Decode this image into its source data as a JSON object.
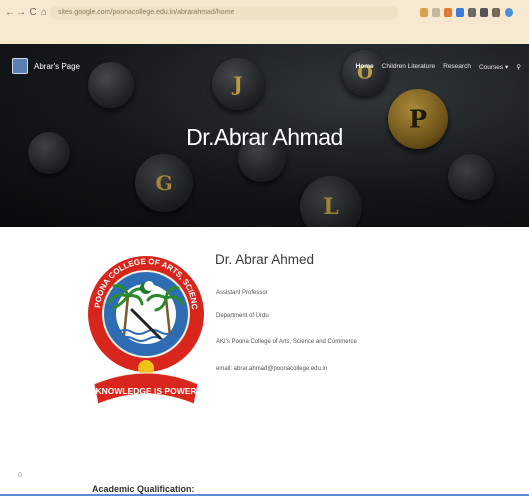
{
  "browser": {
    "back": "←",
    "forward": "→",
    "reload": "C",
    "home": "⌂",
    "url": "sites.google.com/poonacollege.edu.in/abrarahmad/home"
  },
  "site": {
    "brand": "Abrar's Page",
    "nav": [
      {
        "label": "Home",
        "active": true
      },
      {
        "label": "Children Literature",
        "active": false
      },
      {
        "label": "Research",
        "active": false
      },
      {
        "label": "Courses ▾",
        "active": false
      }
    ],
    "hero_title": "Dr.Abrar Ahmad"
  },
  "profile": {
    "name": "Dr. Abrar Ahmed",
    "designation": "Assistant Professor",
    "department": "Department of Urdu",
    "college": "AKI's Poona College of Arts, Science and Commerce",
    "email": "email: abrar.ahmad@poonacollege.edu.in"
  },
  "logo": {
    "top_text": "POONA COLLEGE OF ARTS, SCIENCE & COMMERCE",
    "motto": "KNOWLEDGE IS POWER"
  },
  "page": {
    "side_number": "0",
    "section_heading": "Academic Qualification:"
  },
  "colors": {
    "chrome": "#f7e9cf",
    "logo_red": "#d8261d",
    "logo_blue": "#2e6db4",
    "accent_blue": "#5b8fd6"
  }
}
